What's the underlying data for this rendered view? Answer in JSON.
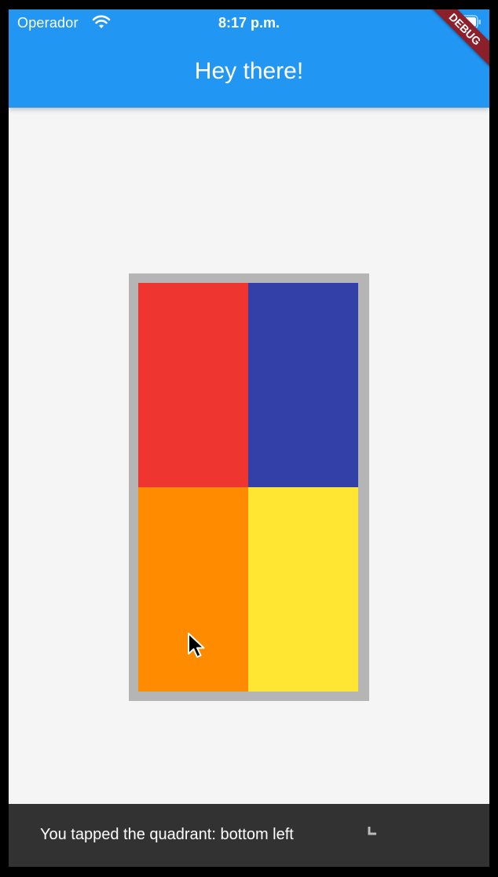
{
  "status_bar": {
    "carrier": "Operador",
    "time": "8:17 p.m.",
    "wifi_icon": "wifi-icon",
    "battery_icon": "battery-icon"
  },
  "app_bar": {
    "title": "Hey there!",
    "color": "#2196f3"
  },
  "debug_banner": {
    "label": "DEBUG",
    "color": "#8b1f2a"
  },
  "quadrants": {
    "frame_color": "#b5b5b5",
    "items": [
      {
        "position": "top left",
        "color": "#ee3530"
      },
      {
        "position": "top right",
        "color": "#3340a8"
      },
      {
        "position": "bottom left",
        "color": "#ff8c00"
      },
      {
        "position": "bottom right",
        "color": "#ffe633"
      }
    ]
  },
  "snackbar": {
    "message": "You tapped the quadrant: bottom left",
    "color": "#323232"
  },
  "pointer_icon": "mouse-cursor-icon"
}
